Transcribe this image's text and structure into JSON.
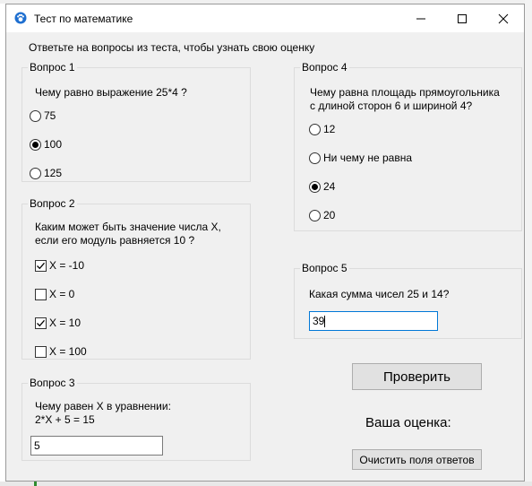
{
  "window": {
    "title": "Тест по математике",
    "icon": "paw-icon",
    "controls": [
      "minimize-icon",
      "maximize-icon",
      "close-icon"
    ]
  },
  "instruction": "Ответьте на вопросы из теста, чтобы узнать свою оценку",
  "q1": {
    "title": "Вопрос 1",
    "text": "Чему равно выражение 25*4 ?",
    "options": [
      {
        "label": "75",
        "selected": false
      },
      {
        "label": "100",
        "selected": true
      },
      {
        "label": "125",
        "selected": false
      }
    ]
  },
  "q2": {
    "title": "Вопрос 2",
    "text_line1": "Каким может быть значение числа X,",
    "text_line2": "если его модуль равняется 10 ?",
    "options": [
      {
        "label": "X = -10",
        "checked": true
      },
      {
        "label": "X = 0",
        "checked": false
      },
      {
        "label": "X = 10",
        "checked": true
      },
      {
        "label": "X = 100",
        "checked": false
      }
    ]
  },
  "q3": {
    "title": "Вопрос 3",
    "text_line1": "Чему равен X в уравнении:",
    "text_line2": "2*X + 5 = 15",
    "answer": "5"
  },
  "q4": {
    "title": "Вопрос 4",
    "text_line1": "Чему равна площадь прямоугольника",
    "text_line2": "с длиной сторон 6 и шириной 4?",
    "options": [
      {
        "label": "12",
        "selected": false
      },
      {
        "label": "Ни чему не равна",
        "selected": false
      },
      {
        "label": "24",
        "selected": true
      },
      {
        "label": "20",
        "selected": false
      }
    ]
  },
  "q5": {
    "title": "Вопрос 5",
    "text": "Какая сумма чисел 25 и 14?",
    "answer": "39"
  },
  "actions": {
    "check_label": "Проверить",
    "score_label": "Ваша оценка:",
    "clear_label": "Очистить поля ответов"
  }
}
